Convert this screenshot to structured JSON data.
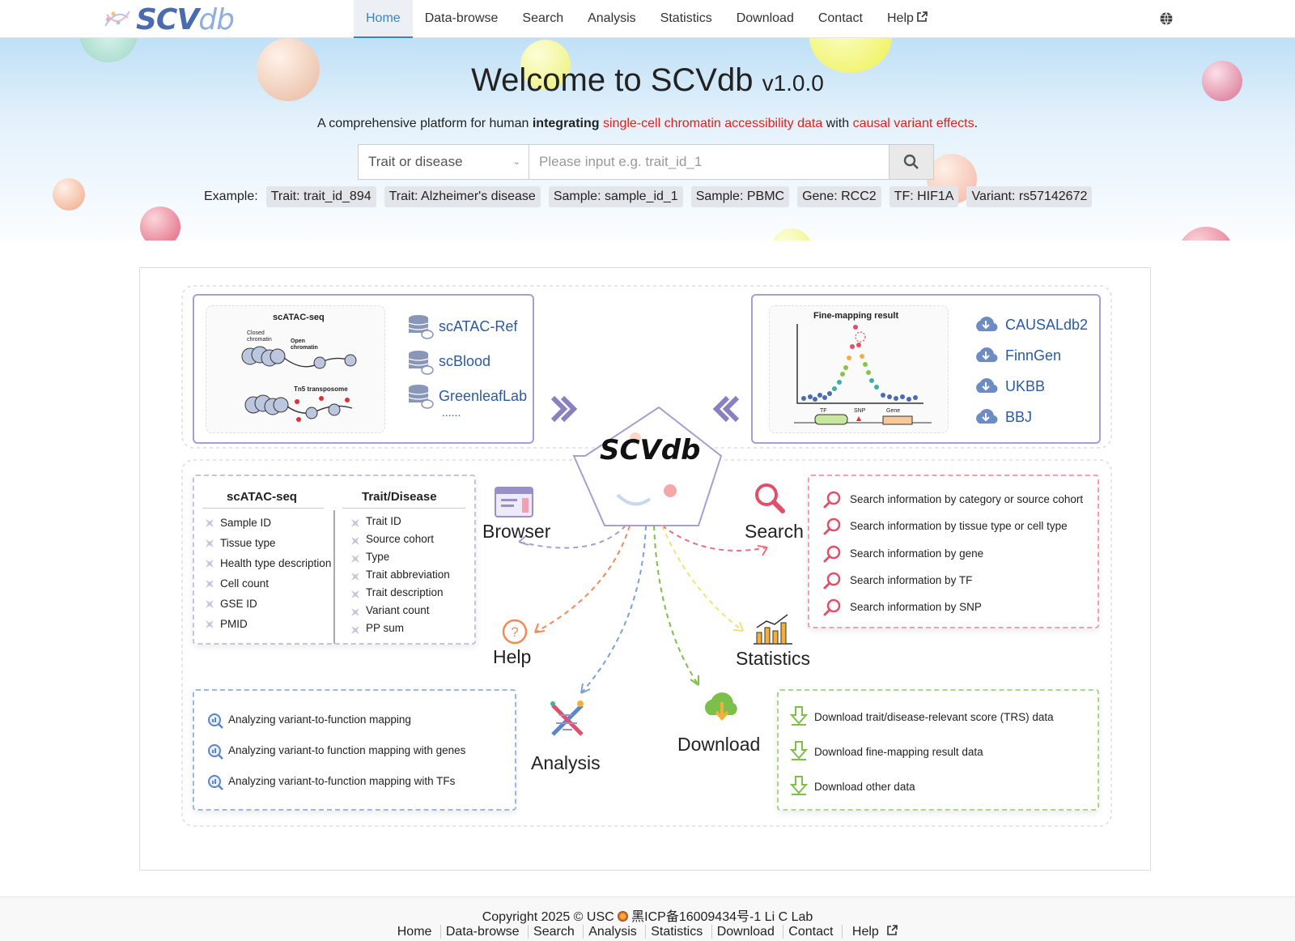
{
  "nav": {
    "logo_main": "SCV",
    "logo_db": "db",
    "items": [
      "Home",
      "Data-browse",
      "Search",
      "Analysis",
      "Statistics",
      "Download",
      "Contact",
      "Help"
    ],
    "help_ext": "⧉"
  },
  "hero": {
    "title": "Welcome to SCVdb",
    "version": "v1.0.0",
    "subtitle_prefix": "A comprehensive platform for human ",
    "subtitle_bold": "integrating",
    "subtitle_red1": "single-cell chromatin accessibility data",
    "subtitle_mid": " with ",
    "subtitle_red2": "causal variant effects",
    "subtitle_end": "."
  },
  "search": {
    "select_value": "Trait or disease",
    "placeholder": "Please input  e.g. trait_id_1"
  },
  "examples": {
    "label": "Example:",
    "chips": [
      "Trait: trait_id_894",
      "Trait: Alzheimer's disease",
      "Sample: sample_id_1",
      "Sample: PBMC",
      "Gene: RCC2",
      "TF: HIF1A",
      "Variant: rs57142672"
    ]
  },
  "diagram": {
    "center": "SCVdb",
    "scatac_title": "scATAC-seq",
    "closed_chromatin": "Closed chromatin",
    "open_chromatin": "Open chromatin",
    "tn5": "Tn5 transposome",
    "db_sources": [
      "scATAC-Ref",
      "scBlood",
      "GreenleafLab"
    ],
    "db_more": "......",
    "finemap_title": "Fine-mapping result",
    "tf": "TF",
    "snp": "SNP",
    "gene": "Gene",
    "dl_sources": [
      "CAUSALdb2",
      "FinnGen",
      "UKBB",
      "BBJ"
    ],
    "browse_col1_title": "scATAC-seq",
    "browse_col1": [
      "Sample ID",
      "Tissue type",
      "Health type description",
      "Cell count",
      "GSE ID",
      "PMID"
    ],
    "browse_col2_title": "Trait/Disease",
    "browse_col2": [
      "Trait ID",
      "Source cohort",
      "Type",
      "Trait abbreviation",
      "Trait description",
      "Variant count",
      "PP sum"
    ],
    "nodes": {
      "browser": "Browser",
      "search": "Search",
      "help": "Help",
      "statistics": "Statistics",
      "analysis": "Analysis",
      "download": "Download"
    },
    "search_items": [
      "Search information by category or source cohort",
      "Search information by tissue type or cell type",
      "Search information by gene",
      "Search information by TF",
      "Search information by SNP"
    ],
    "analysis_items": [
      "Analyzing variant-to-function mapping",
      "Analyzing variant-to function mapping with genes",
      "Analyzing variant-to-function mapping with TFs"
    ],
    "download_items": [
      "Download trait/disease-relevant score (TRS) data",
      "Download fine-mapping result data",
      "Download other data"
    ]
  },
  "footer": {
    "copyright": "Copyright 2025 © USC ",
    "icp": "黑ICP备16009434号-1 Li C Lab",
    "links": [
      "Home",
      "Data-browse",
      "Search",
      "Analysis",
      "Statistics",
      "Download",
      "Contact",
      "Help"
    ]
  }
}
